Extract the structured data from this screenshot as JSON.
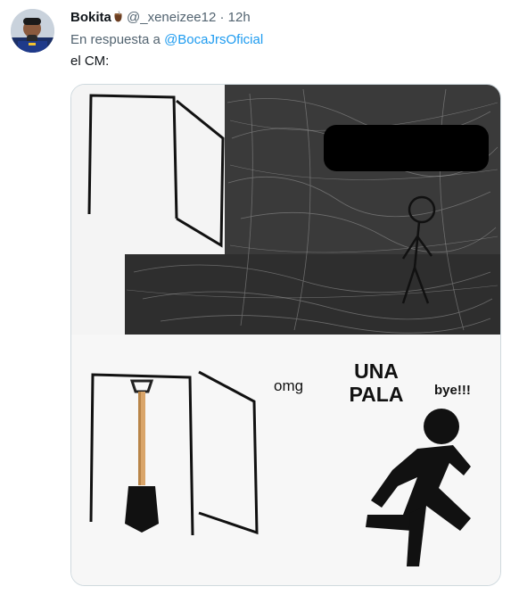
{
  "author": {
    "display_name": "Bokita",
    "name_emoji": "mate-cup-icon",
    "handle": "@_xeneizee12",
    "separator": "·",
    "time": "12h"
  },
  "reply": {
    "prefix": "En respuesta a",
    "mention": "@BocaJrsOficial"
  },
  "tweet_text": "el CM:",
  "meme": {
    "caption_omg": "omg",
    "caption_una": "UNA",
    "caption_pala": "PALA",
    "caption_bye": "bye!!!"
  },
  "colors": {
    "link": "#1d9bf0",
    "muted": "#536471",
    "border": "#cfd9de"
  }
}
